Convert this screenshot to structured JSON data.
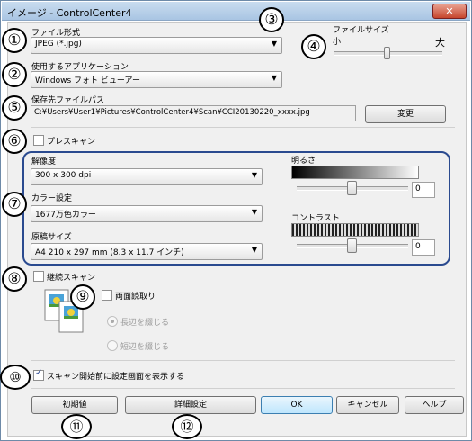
{
  "window": {
    "title": "イメージ - ControlCenter4",
    "close": "✕"
  },
  "file_format": {
    "label": "ファイル形式",
    "value": "JPEG (*.jpg)"
  },
  "file_size": {
    "label": "ファイルサイズ",
    "min_label": "小",
    "max_label": "大",
    "level": 0.5
  },
  "app": {
    "label": "使用するアプリケーション",
    "value": "Windows フォト ビューアー"
  },
  "save_path": {
    "label": "保存先ファイルパス",
    "value": "C:¥Users¥User1¥Pictures¥ControlCenter4¥Scan¥CCI20130220_xxxx.jpg",
    "change_button": "変更"
  },
  "prescan": {
    "label": "プレスキャン",
    "checked": false
  },
  "resolution": {
    "label": "解像度",
    "value": "300 x 300 dpi"
  },
  "color": {
    "label": "カラー設定",
    "value": "1677万色カラー"
  },
  "doc_size": {
    "label": "原稿サイズ",
    "value": "A4 210 x 297 mm (8.3 x 11.7 インチ)"
  },
  "brightness": {
    "label": "明るさ",
    "value": "0"
  },
  "contrast": {
    "label": "コントラスト",
    "value": "0"
  },
  "continuous": {
    "label": "継続スキャン",
    "checked": false
  },
  "duplex": {
    "label": "両面読取り",
    "checked": false
  },
  "long_edge": {
    "label": "長辺を綴じる"
  },
  "short_edge": {
    "label": "短辺を綴じる"
  },
  "show_settings": {
    "label": "スキャン開始前に設定画面を表示する",
    "checked": true
  },
  "buttons": {
    "defaults": "初期値",
    "advanced": "詳細設定",
    "ok": "OK",
    "cancel": "キャンセル",
    "help": "ヘルプ"
  },
  "annotations": [
    "①",
    "②",
    "③",
    "④",
    "⑤",
    "⑥",
    "⑦",
    "⑧",
    "⑨",
    "⑩",
    "⑪",
    "⑫"
  ],
  "colors": {
    "annotation_group_border": "#2a4a8f",
    "title_gradient_top": "#c9dcef",
    "close_button": "#c6452c"
  }
}
